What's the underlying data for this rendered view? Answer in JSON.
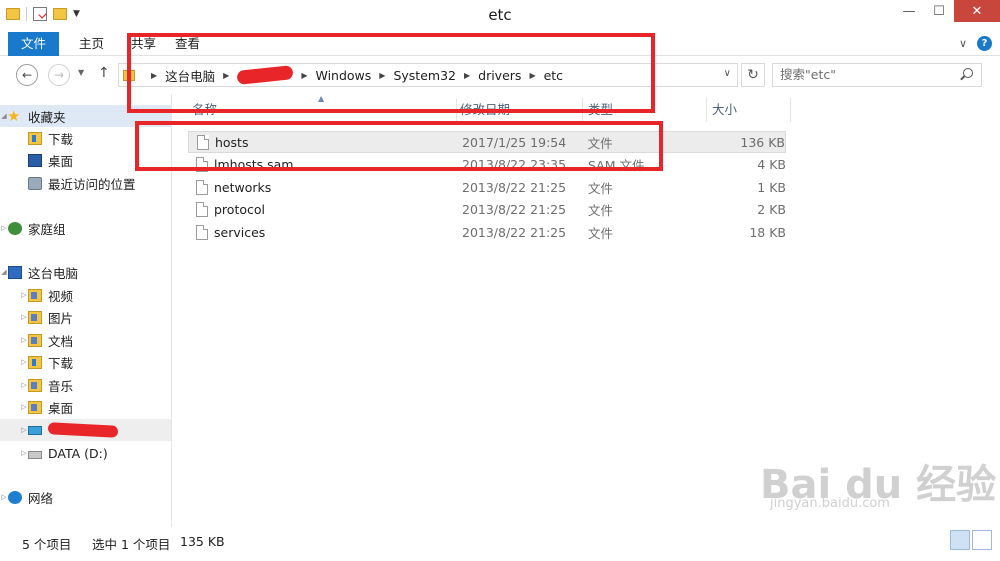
{
  "window": {
    "title": "etc",
    "controls": {
      "minimize": "—",
      "maximize": "☐",
      "close": "✕"
    }
  },
  "ribbon": {
    "tabs": [
      "文件",
      "主页",
      "共享",
      "查看"
    ]
  },
  "address": {
    "crumbs": [
      "这台电脑",
      "Windows",
      "System32",
      "drivers",
      "etc"
    ],
    "search_placeholder": "搜索\"etc\""
  },
  "sidebar": {
    "favorites": {
      "label": "收藏夹",
      "items": [
        "下载",
        "桌面",
        "最近访问的位置"
      ]
    },
    "homegroup": "家庭组",
    "this_pc": {
      "label": "这台电脑",
      "items": [
        "视频",
        "图片",
        "文档",
        "下载",
        "音乐",
        "桌面"
      ]
    },
    "drive_d": "DATA (D:)",
    "network": "网络"
  },
  "columns": {
    "name": "名称",
    "date": "修改日期",
    "type": "类型",
    "size": "大小"
  },
  "files": [
    {
      "name": "hosts",
      "date": "2017/1/25 19:54",
      "type": "文件",
      "size": "136 KB",
      "selected": true
    },
    {
      "name": "lmhosts.sam",
      "date": "2013/8/22 23:35",
      "type": "SAM 文件",
      "size": "4 KB",
      "selected": false
    },
    {
      "name": "networks",
      "date": "2013/8/22 21:25",
      "type": "文件",
      "size": "1 KB",
      "selected": false
    },
    {
      "name": "protocol",
      "date": "2013/8/22 21:25",
      "type": "文件",
      "size": "2 KB",
      "selected": false
    },
    {
      "name": "services",
      "date": "2013/8/22 21:25",
      "type": "文件",
      "size": "18 KB",
      "selected": false
    }
  ],
  "status": {
    "count": "5 个项目",
    "selected": "选中 1 个项目",
    "size": "135 KB"
  },
  "watermark": {
    "logo": "Bai du 经验",
    "url": "jingyan.baidu.com"
  },
  "colors": {
    "accent": "#1979ca",
    "annotation": "#e8262a",
    "close": "#c9463d"
  }
}
